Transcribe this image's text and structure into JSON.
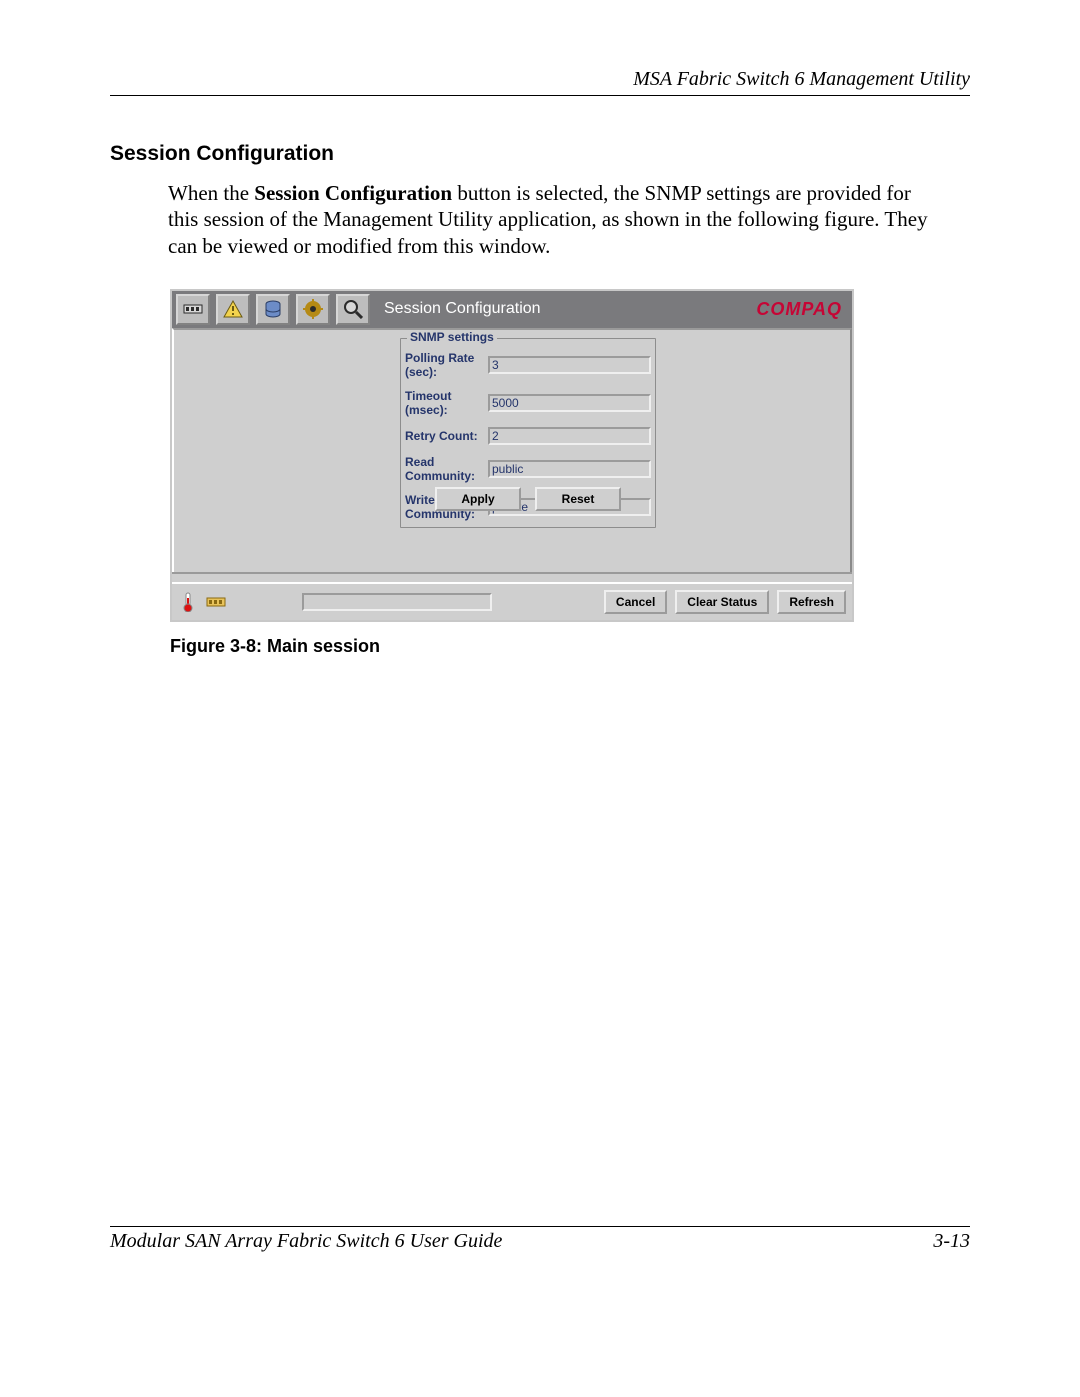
{
  "doc": {
    "header_right": "MSA Fabric Switch 6 Management Utility",
    "section_heading": "Session Configuration",
    "body_pre": "When the ",
    "body_bold": "Session Configuration",
    "body_post": " button is selected, the SNMP settings are provided for this session of the Management Utility application, as shown in the following figure. They can be viewed or modified from this window.",
    "figure_caption": "Figure 3-8:  Main session",
    "footer_left": "Modular SAN Array Fabric Switch 6 User Guide",
    "footer_right": "3-13"
  },
  "app": {
    "toolbar_title": "Session Configuration",
    "brand": "COMPAQ",
    "fieldset_legend": "SNMP settings",
    "labels": {
      "polling": "Polling Rate (sec):",
      "timeout": "Timeout (msec):",
      "retry": "Retry Count:",
      "readc": "Read Community:",
      "writec": "Write Community:"
    },
    "values": {
      "polling": "3",
      "timeout": "5000",
      "retry": "2",
      "readc": "public",
      "writec": "private"
    },
    "buttons": {
      "apply": "Apply",
      "reset": "Reset",
      "cancel": "Cancel",
      "clear_status": "Clear Status",
      "refresh": "Refresh"
    }
  }
}
